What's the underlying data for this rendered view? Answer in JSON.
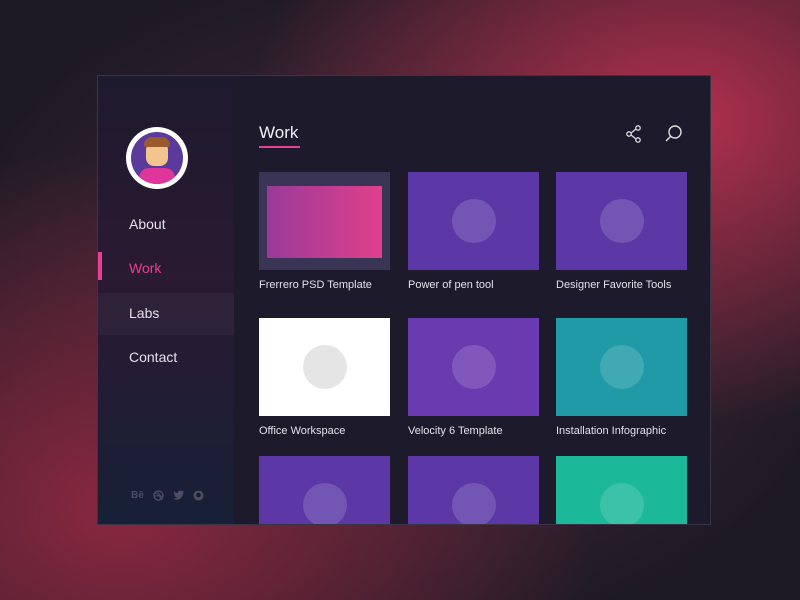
{
  "sidebar": {
    "nav": [
      {
        "label": "About",
        "active": false
      },
      {
        "label": "Work",
        "active": true
      },
      {
        "label": "Labs",
        "active": false
      },
      {
        "label": "Contact",
        "active": false
      }
    ],
    "social": [
      "Bē",
      "dribbble-icon",
      "twitter-icon",
      "github-icon"
    ],
    "social_behance": "Bē"
  },
  "main": {
    "title": "Work",
    "icons": [
      "share-icon",
      "search-icon"
    ],
    "projects": [
      {
        "title": "Frerrero PSD Template",
        "color": "#d63a8e"
      },
      {
        "title": "Power of pen tool",
        "color": "#5b38a6"
      },
      {
        "title": "Designer Favorite Tools",
        "color": "#5b38a6"
      },
      {
        "title": "Office Workspace",
        "color": "#ffffff"
      },
      {
        "title": "Velocity 6 Template",
        "color": "#6a3ab0"
      },
      {
        "title": "Installation Infographic",
        "color": "#1f9aa6"
      },
      {
        "title": "",
        "color": "#5b38a6"
      },
      {
        "title": "",
        "color": "#5b38a6"
      },
      {
        "title": "",
        "color": "#1bb89a"
      }
    ]
  },
  "colors": {
    "accent": "#e83e96"
  }
}
